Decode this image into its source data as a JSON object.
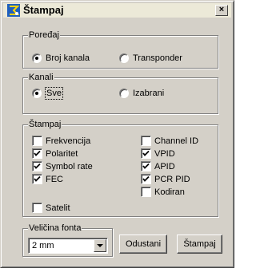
{
  "window": {
    "title": "Štampaj",
    "close_glyph": "×",
    "title_icon": "app-icon"
  },
  "sort": {
    "legend": "Poređaj",
    "options": [
      {
        "label": "Broj kanala",
        "selected": true
      },
      {
        "label": "Transponder",
        "selected": false
      }
    ]
  },
  "channels": {
    "legend": "Kanali",
    "options": [
      {
        "label": "Sve",
        "selected": true
      },
      {
        "label": "Izabrani",
        "selected": false
      }
    ]
  },
  "print": {
    "legend": "Štampaj",
    "left": [
      {
        "label": "Frekvencija",
        "checked": false
      },
      {
        "label": "Polaritet",
        "checked": true
      },
      {
        "label": "Symbol rate",
        "checked": true
      },
      {
        "label": "FEC",
        "checked": true
      }
    ],
    "right": [
      {
        "label": "Channel ID",
        "checked": false
      },
      {
        "label": "VPID",
        "checked": true
      },
      {
        "label": "APID",
        "checked": true
      },
      {
        "label": "PCR PID",
        "checked": true
      },
      {
        "label": "Kodiran",
        "checked": false
      }
    ],
    "satelit": {
      "label": "Satelit",
      "checked": false
    }
  },
  "font_size": {
    "legend": "Veličina fonta",
    "value": "2 mm"
  },
  "buttons": {
    "cancel": "Odustani",
    "print": "Štampaj"
  }
}
